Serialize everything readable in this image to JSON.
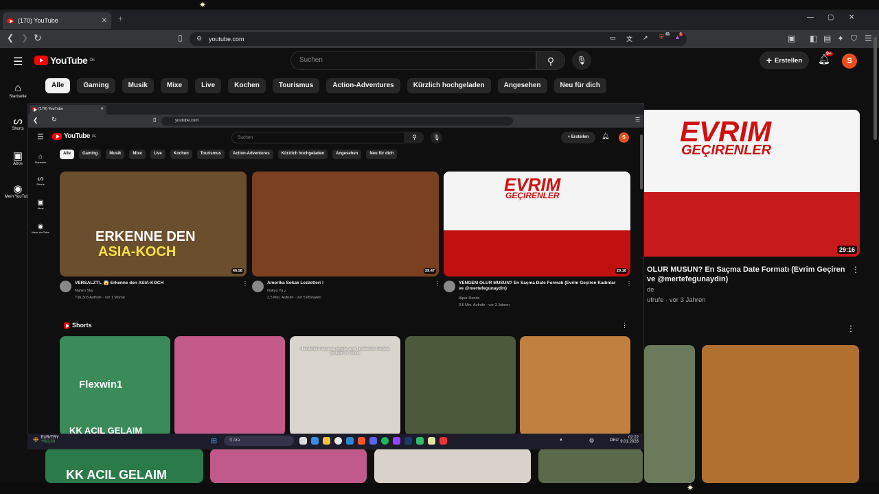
{
  "browser": {
    "tab_title": "(170) YouTube",
    "tab_new": "+",
    "url": "youtube.com",
    "ext_badge1": "42",
    "ext_badge2": "1"
  },
  "yt": {
    "logo": "YouTube",
    "region": "DE",
    "search_placeholder": "Suchen",
    "create_label": "Erstellen",
    "notif_badge": "9+",
    "avatar_letter": "S",
    "chips": [
      "Alle",
      "Gaming",
      "Musik",
      "Mixe",
      "Live",
      "Kochen",
      "Tourismus",
      "Action-Adventures",
      "Kürzlich hochgeladen",
      "Angesehen",
      "Neu für dich"
    ],
    "sidebar": [
      "Startseite",
      "Shorts",
      "Abos",
      "Mein YouTube"
    ]
  },
  "outer_video": {
    "duration": "29:16",
    "title_line1": "OLUR MUSUN? En Saçma Date Formatı (Evrim Geçiren",
    "title_line2": "ve @mertefegunaydin)",
    "channel": "de",
    "meta": "ufrufe · vor 3 Jahren",
    "thumb_text1": "EVRIM",
    "thumb_text2": "GEÇIRENLER"
  },
  "outer_shorts": {
    "text": "KK ACIL GELAIM"
  },
  "inner": {
    "tab_title": "(170) YouTube",
    "url": "youtube.com",
    "videos": [
      {
        "title": "VERSALZT!.. 😱 Erkenne den ASIA-KOCH",
        "channel": "Nahim Sky",
        "meta": "730.303 Aufrufe · vor 1 Monat",
        "duration": "46:58",
        "thumb_line1": "ERKENNE DEN",
        "thumb_line2": "ASIA-KOCH",
        "color": "#6b4e2e"
      },
      {
        "title": "Amerika Sokak Lezzetleri !",
        "channel": "Nokyo Ya ¿",
        "meta": "2,5 Mio. Aufrufe · vor 5 Monaten",
        "duration": "39:47",
        "thumb_line1": "",
        "thumb_line2": "",
        "color": "#7a4020"
      },
      {
        "title": "YENGEM OLUR MUSUN? En Saçma Date Formatı (Evrim Geçiren Kadınlar ve @mertefegunaydin)",
        "channel": "Alper Rende",
        "meta": "3,5 Mio. Aufrufe · vor 3 Jahren",
        "duration": "29:16",
        "thumb_line1": "EVRIM",
        "thumb_line2": "GEÇIRENLER",
        "color": "#c01010"
      }
    ],
    "shorts_label": "Shorts",
    "shorts": [
      {
        "text": "Flexwin1",
        "bottom": "KK ACIL GELAIM",
        "color": "#3a8a5a"
      },
      {
        "text": "",
        "bottom": "",
        "color": "#c45a8a"
      },
      {
        "text": "Hamileliğim boyunca hergün aynı kıyafetlerle fotoğraf çekildim ve sonuç",
        "bottom": "",
        "color": "#d9d4cc"
      },
      {
        "text": "",
        "bottom": "",
        "color": "#4a5a3a"
      },
      {
        "text": "",
        "bottom": "",
        "color": "#c08040"
      }
    ]
  },
  "taskbar": {
    "currency": "EUR/TRY",
    "change": "+%0,30",
    "search": "Ara",
    "lang": "DEU",
    "time": "02:22",
    "date": "9.01.2026"
  }
}
